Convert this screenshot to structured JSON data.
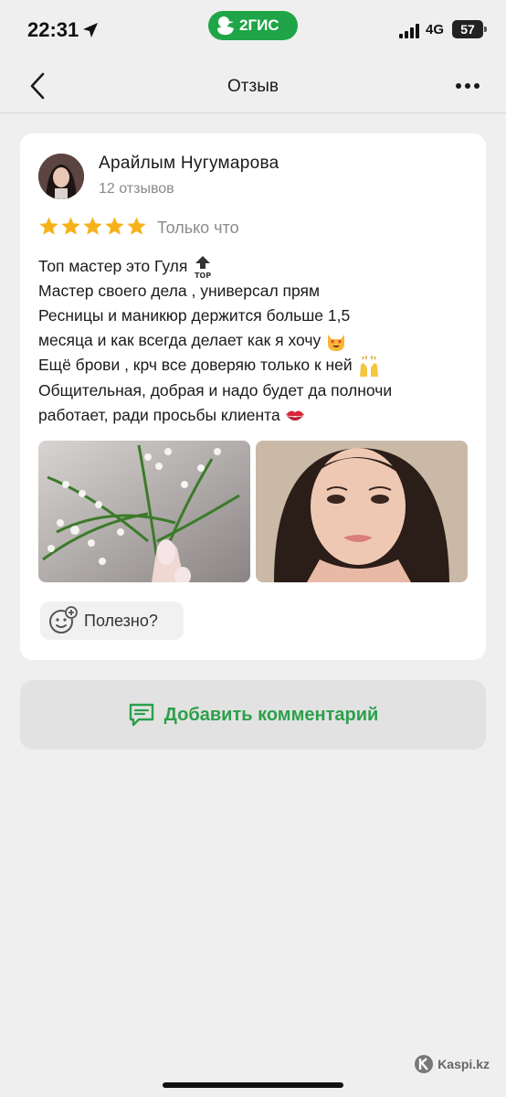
{
  "status_bar": {
    "time": "22:31",
    "app_badge": "2ГИС",
    "network": "4G",
    "battery": "57"
  },
  "nav": {
    "title": "Отзыв",
    "back_icon": "chevron-left-icon",
    "more_icon": "more-horizontal-icon"
  },
  "review": {
    "author": "Арайлым Нугумарова",
    "review_count": "12 отзывов",
    "rating": 5,
    "rating_max": 5,
    "time": "Только что",
    "lines": [
      "Топ мастер это Гуля",
      "Мастер своего дела , универсал прям",
      "Ресницы и маникюр держится больше 1,5",
      "месяца и как всегда делает как я хочу",
      "Ещё брови , крч все доверяю только к ней",
      "Общительная, добрая и надо будет да полночи",
      "работает, ради просьбы клиента"
    ],
    "helpful_label": "Полезно?"
  },
  "actions": {
    "add_comment": "Добавить комментарий"
  },
  "watermark": "Kaspi.kz",
  "colors": {
    "accent_green": "#2ca04a",
    "badge_green": "#1fa547",
    "star": "#f6b21a"
  }
}
